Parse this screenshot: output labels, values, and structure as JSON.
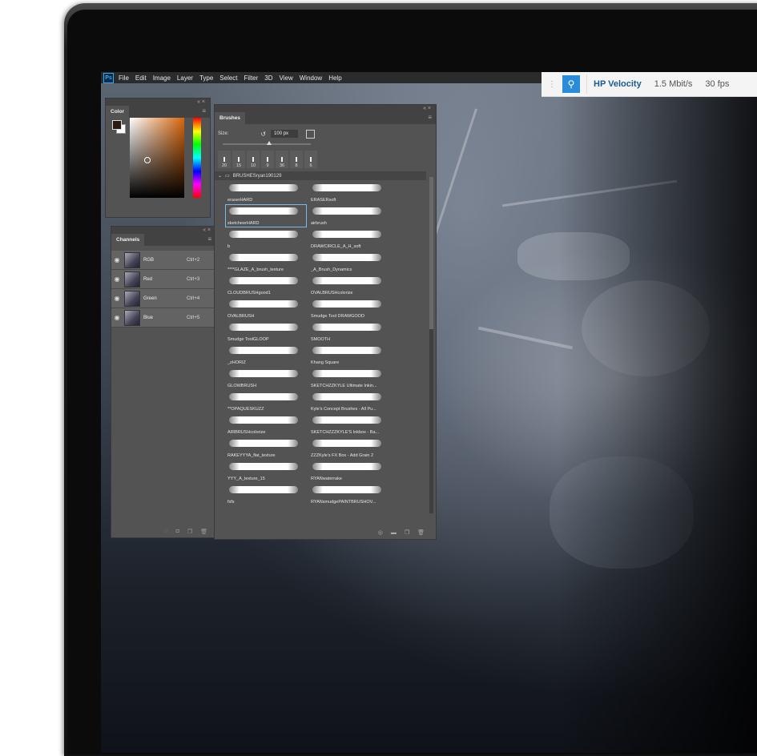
{
  "menubar": {
    "logo": "Ps",
    "items": [
      "File",
      "Edit",
      "Image",
      "Layer",
      "Type",
      "Select",
      "Filter",
      "3D",
      "View",
      "Window",
      "Help"
    ]
  },
  "hp_velocity": {
    "title": "HP Velocity",
    "bandwidth": "1.5 Mbit/s",
    "fps": "30 fps"
  },
  "color_panel": {
    "tab": "Color"
  },
  "channels_panel": {
    "tab": "Channels",
    "rows": [
      {
        "name": "RGB",
        "shortcut": "Ctrl+2"
      },
      {
        "name": "Red",
        "shortcut": "Ctrl+3"
      },
      {
        "name": "Green",
        "shortcut": "Ctrl+4"
      },
      {
        "name": "Blue",
        "shortcut": "Ctrl+5"
      }
    ]
  },
  "brushes_panel": {
    "tab": "Brushes",
    "size_label": "Size:",
    "size_value": "100 px",
    "presets": [
      "20",
      "15",
      "10",
      "9",
      "36",
      "8",
      "6"
    ],
    "folder": "BRUSHESryan190129",
    "brushes": [
      "eraserHARD",
      "ERASERsoft",
      "sketcheerHARD",
      "airbrush",
      "b",
      "DRAWCIRCLE_A_H_soft",
      "****GLAZE_A_brush_texture",
      "_A_Brush_Dynamics",
      "CLOUDBRUSHgood1",
      "OVALBRUSHcolorize",
      "OVALBRUSH",
      "Smudge Tool DRAWGOOD",
      "Smudge ToolGLOOP",
      "SMOOTH",
      "_zHORIZ",
      "Khang Square",
      "GLOWBRUSH",
      "SKETCHZZKYLE Ultimate Inkin...",
      "**OPAQUESKUZZ",
      "Kyle's Concept Brushes - All Pu...",
      "AIRBRUSHcolorize",
      "SKETCHZZZKYLE'S Inkbox - Ba...",
      "RAKEYYYA_flat_texture",
      "ZZZKyle's FX Box - Add Grain 2",
      "YYY_A_texture_15",
      "RYANwaterrake",
      "fsfs",
      "RYANsmudgePAINTBRUSHOV..."
    ],
    "selected_index": 2
  }
}
